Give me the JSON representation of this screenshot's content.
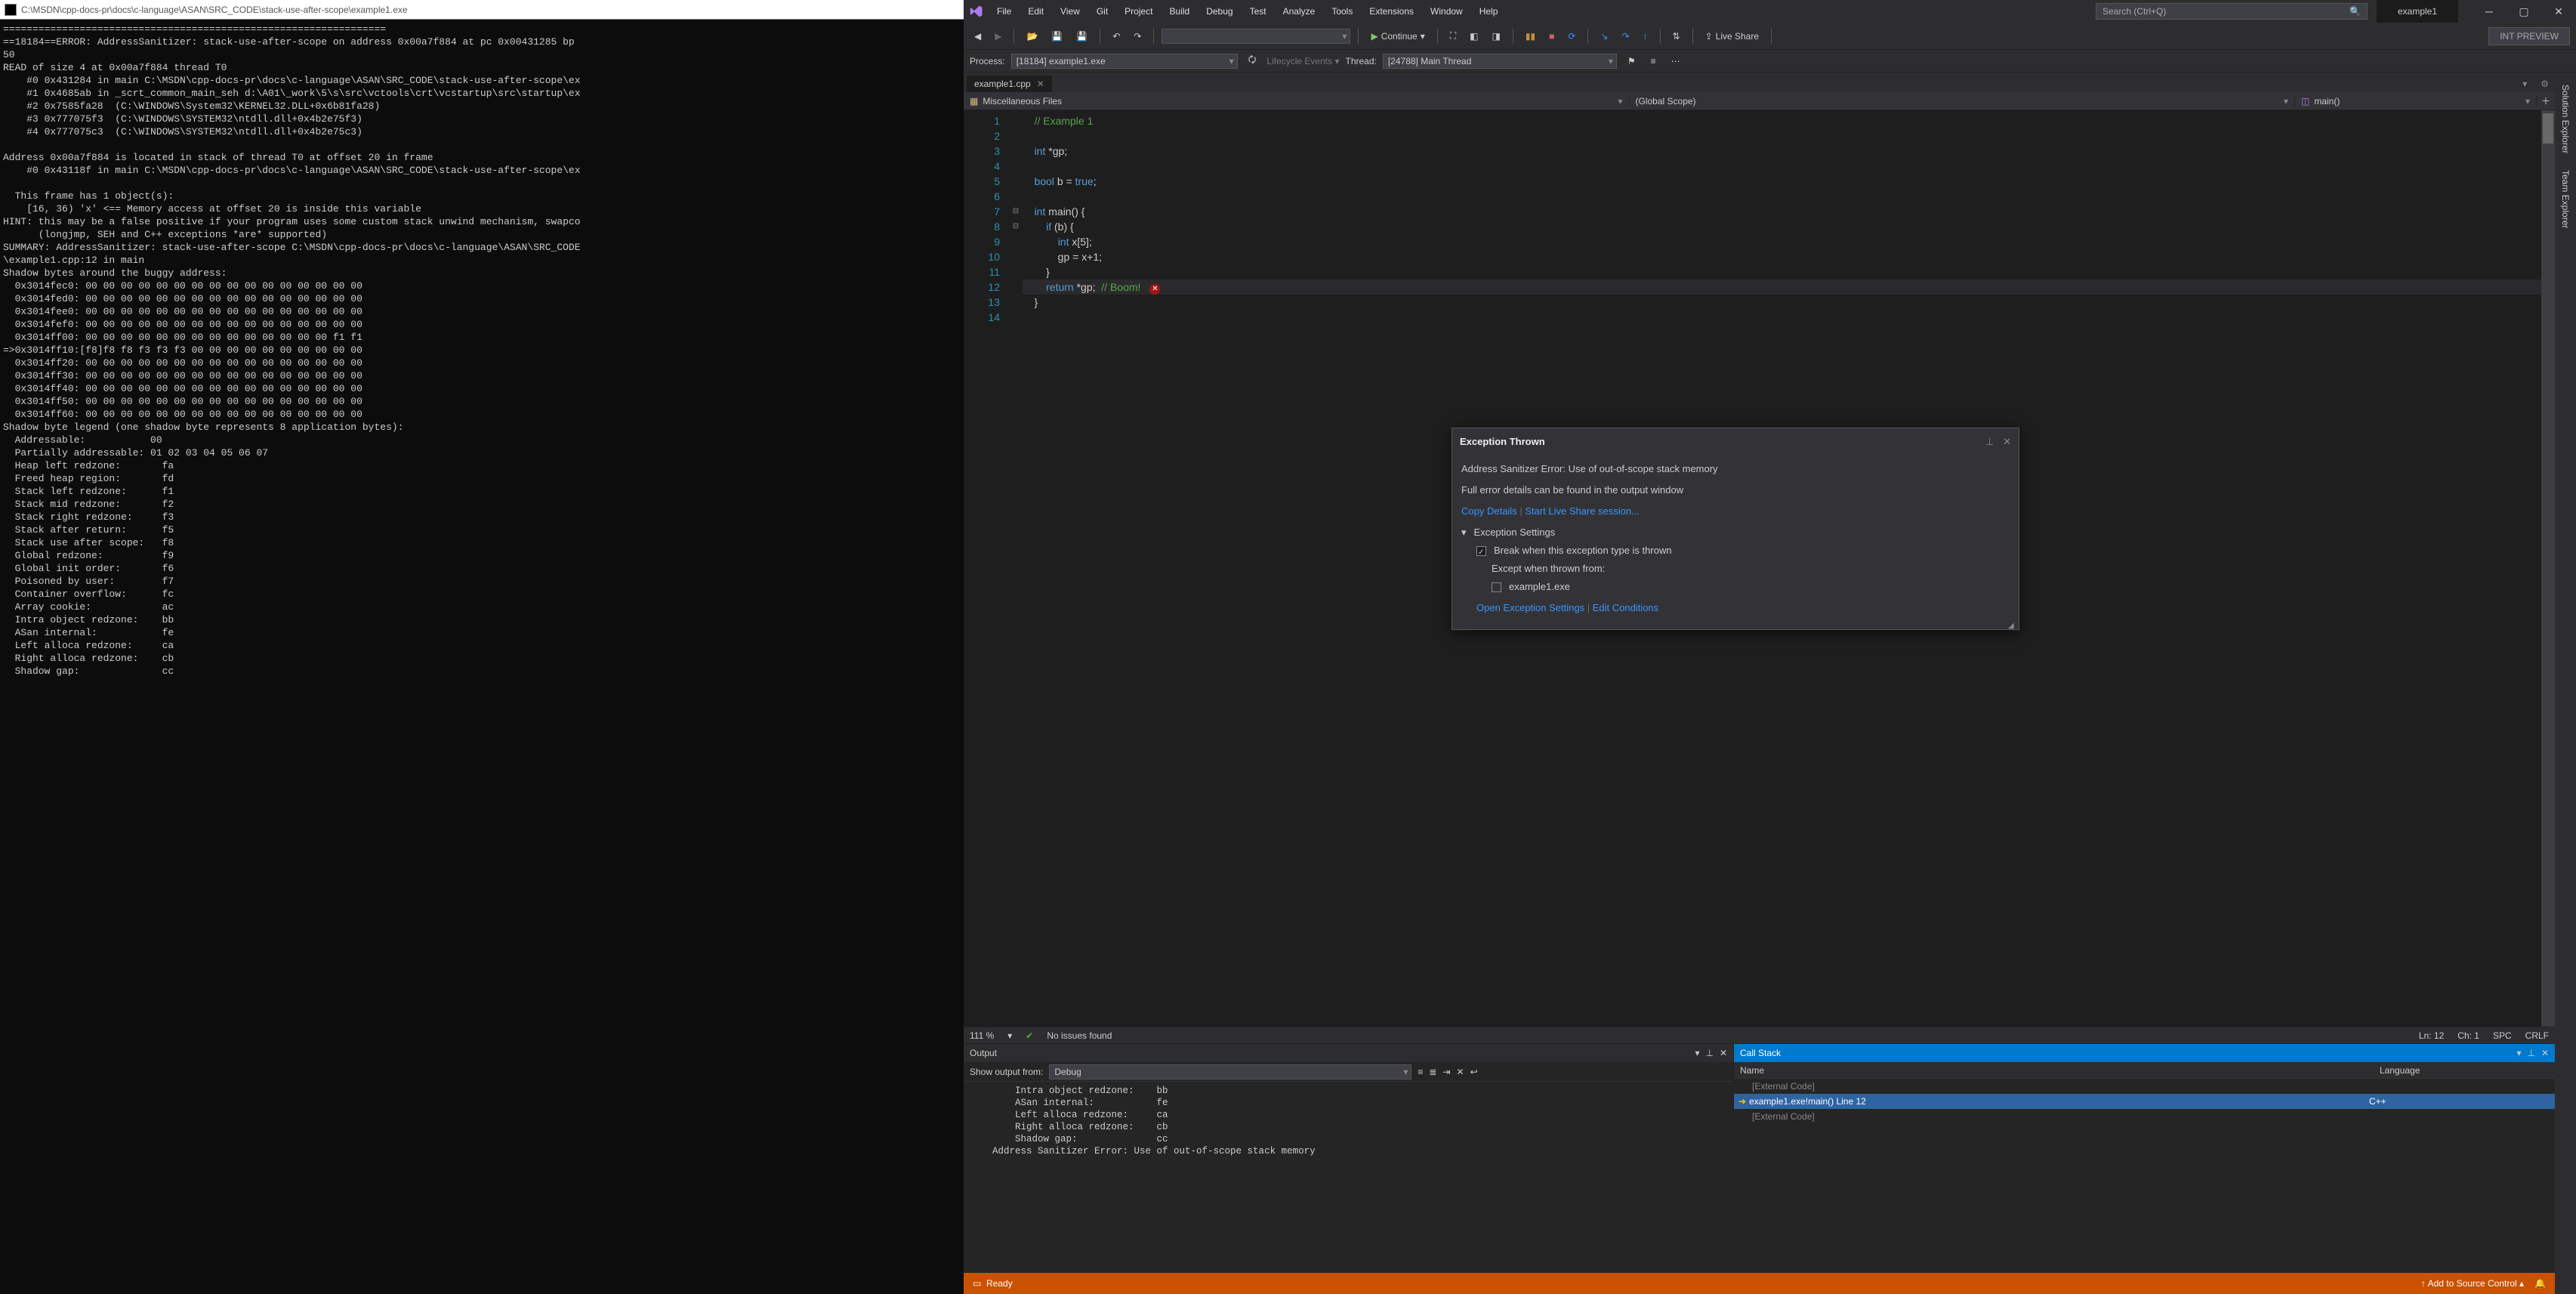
{
  "console": {
    "title": "C:\\MSDN\\cpp-docs-pr\\docs\\c-language\\ASAN\\SRC_CODE\\stack-use-after-scope\\example1.exe",
    "text": "=================================================================\n==18184==ERROR: AddressSanitizer: stack-use-after-scope on address 0x00a7f884 at pc 0x00431285 bp\n50\nREAD of size 4 at 0x00a7f884 thread T0\n    #0 0x431284 in main C:\\MSDN\\cpp-docs-pr\\docs\\c-language\\ASAN\\SRC_CODE\\stack-use-after-scope\\ex\n    #1 0x4685ab in _scrt_common_main_seh d:\\A01\\_work\\5\\s\\src\\vctools\\crt\\vcstartup\\src\\startup\\ex\n    #2 0x7585fa28  (C:\\WINDOWS\\System32\\KERNEL32.DLL+0x6b81fa28)\n    #3 0x777075f3  (C:\\WINDOWS\\SYSTEM32\\ntdll.dll+0x4b2e75f3)\n    #4 0x777075c3  (C:\\WINDOWS\\SYSTEM32\\ntdll.dll+0x4b2e75c3)\n\nAddress 0x00a7f884 is located in stack of thread T0 at offset 20 in frame\n    #0 0x43118f in main C:\\MSDN\\cpp-docs-pr\\docs\\c-language\\ASAN\\SRC_CODE\\stack-use-after-scope\\ex\n\n  This frame has 1 object(s):\n    [16, 36) 'x' <== Memory access at offset 20 is inside this variable\nHINT: this may be a false positive if your program uses some custom stack unwind mechanism, swapco\n      (longjmp, SEH and C++ exceptions *are* supported)\nSUMMARY: AddressSanitizer: stack-use-after-scope C:\\MSDN\\cpp-docs-pr\\docs\\c-language\\ASAN\\SRC_CODE\n\\example1.cpp:12 in main\nShadow bytes around the buggy address:\n  0x3014fec0: 00 00 00 00 00 00 00 00 00 00 00 00 00 00 00 00\n  0x3014fed0: 00 00 00 00 00 00 00 00 00 00 00 00 00 00 00 00\n  0x3014fee0: 00 00 00 00 00 00 00 00 00 00 00 00 00 00 00 00\n  0x3014fef0: 00 00 00 00 00 00 00 00 00 00 00 00 00 00 00 00\n  0x3014ff00: 00 00 00 00 00 00 00 00 00 00 00 00 00 00 f1 f1\n=>0x3014ff10:[f8]f8 f8 f3 f3 f3 00 00 00 00 00 00 00 00 00 00\n  0x3014ff20: 00 00 00 00 00 00 00 00 00 00 00 00 00 00 00 00\n  0x3014ff30: 00 00 00 00 00 00 00 00 00 00 00 00 00 00 00 00\n  0x3014ff40: 00 00 00 00 00 00 00 00 00 00 00 00 00 00 00 00\n  0x3014ff50: 00 00 00 00 00 00 00 00 00 00 00 00 00 00 00 00\n  0x3014ff60: 00 00 00 00 00 00 00 00 00 00 00 00 00 00 00 00\nShadow byte legend (one shadow byte represents 8 application bytes):\n  Addressable:           00\n  Partially addressable: 01 02 03 04 05 06 07\n  Heap left redzone:       fa\n  Freed heap region:       fd\n  Stack left redzone:      f1\n  Stack mid redzone:       f2\n  Stack right redzone:     f3\n  Stack after return:      f5\n  Stack use after scope:   f8\n  Global redzone:          f9\n  Global init order:       f6\n  Poisoned by user:        f7\n  Container overflow:      fc\n  Array cookie:            ac\n  Intra object redzone:    bb\n  ASan internal:           fe\n  Left alloca redzone:     ca\n  Right alloca redzone:    cb\n  Shadow gap:              cc"
  },
  "vs": {
    "menus": [
      "File",
      "Edit",
      "View",
      "Git",
      "Project",
      "Build",
      "Debug",
      "Test",
      "Analyze",
      "Tools",
      "Extensions",
      "Window",
      "Help"
    ],
    "search_placeholder": "Search (Ctrl+Q)",
    "solution": "example1",
    "continue_label": "Continue",
    "live_share": "Live Share",
    "int_preview": "INT PREVIEW",
    "process_label": "Process:",
    "process_value": "[18184] example1.exe",
    "lifecycle": "Lifecycle Events",
    "thread_label": "Thread:",
    "thread_value": "[24788] Main Thread",
    "doc_tab": "example1.cpp",
    "crumb1": "Miscellaneous Files",
    "crumb2": "(Global Scope)",
    "crumb3": "main()",
    "side_tabs": [
      "Solution Explorer",
      "Team Explorer"
    ],
    "code_lines": [
      "// Example 1",
      "",
      "int *gp;",
      "",
      "bool b = true;",
      "",
      "int main() {",
      "    if (b) {",
      "        int x[5];",
      "        gp = x+1;",
      "    }",
      "    return *gp;  // Boom!",
      "}",
      ""
    ],
    "ed_status": {
      "zoom": "111 %",
      "issues": "No issues found",
      "ln": "Ln: 12",
      "ch": "Ch: 1",
      "spc": "SPC",
      "crlf": "CRLF"
    },
    "exception": {
      "title": "Exception Thrown",
      "msg": "Address Sanitizer Error: Use of out-of-scope stack memory",
      "detail": "Full error details can be found in the output window",
      "copy": "Copy Details",
      "live": "Start Live Share session...",
      "settings": "Exception Settings",
      "break": "Break when this exception type is thrown",
      "except": "Except when thrown from:",
      "exe": "example1.exe",
      "open": "Open Exception Settings",
      "edit": "Edit Conditions"
    },
    "output": {
      "title": "Output",
      "from_label": "Show output from:",
      "from_value": "Debug",
      "text": "        Intra object redzone:    bb\n        ASan internal:           fe\n        Left alloca redzone:     ca\n        Right alloca redzone:    cb\n        Shadow gap:              cc\n    Address Sanitizer Error: Use of out-of-scope stack memory"
    },
    "callstack": {
      "title": "Call Stack",
      "col1": "Name",
      "col2": "Language",
      "rows": [
        {
          "name": "[External Code]",
          "lang": "",
          "sel": false
        },
        {
          "name": "example1.exe!main() Line 12",
          "lang": "C++",
          "sel": true
        },
        {
          "name": "[External Code]",
          "lang": "",
          "sel": false
        }
      ]
    },
    "status": {
      "ready": "Ready",
      "source": "Add to Source Control"
    }
  }
}
